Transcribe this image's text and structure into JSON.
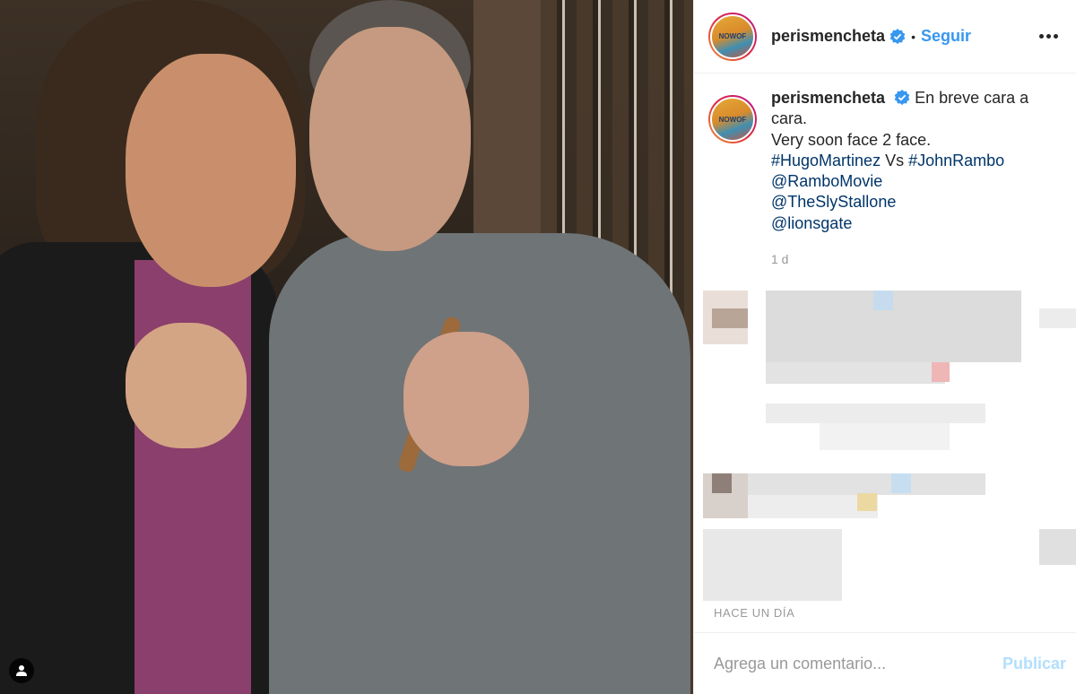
{
  "post": {
    "username": "perismencheta",
    "follow_label": "Seguir",
    "dot": "•",
    "avatar_text": "NOWOF"
  },
  "caption": {
    "username": "perismencheta",
    "line1": "En breve cara a cara.",
    "line2": "Very soon face 2 face.",
    "hashtag1": "#HugoMartinez",
    "vs": "Vs",
    "hashtag2": "#JohnRambo",
    "mention1": "@RamboMovie",
    "mention2": "@TheSlyStallone",
    "mention3": "@lionsgate",
    "time_short": "1 d"
  },
  "footer": {
    "date_label": "HACE UN DÍA",
    "comment_placeholder": "Agrega un comentario...",
    "publish_label": "Publicar"
  },
  "colors": {
    "link": "#003569",
    "follow": "#3897f0",
    "publish_disabled": "#b2dffc",
    "verified": "#3897f0"
  },
  "icons": {
    "verified": "verified-badge-icon",
    "more": "more-options-icon",
    "tag": "user-tag-icon"
  }
}
